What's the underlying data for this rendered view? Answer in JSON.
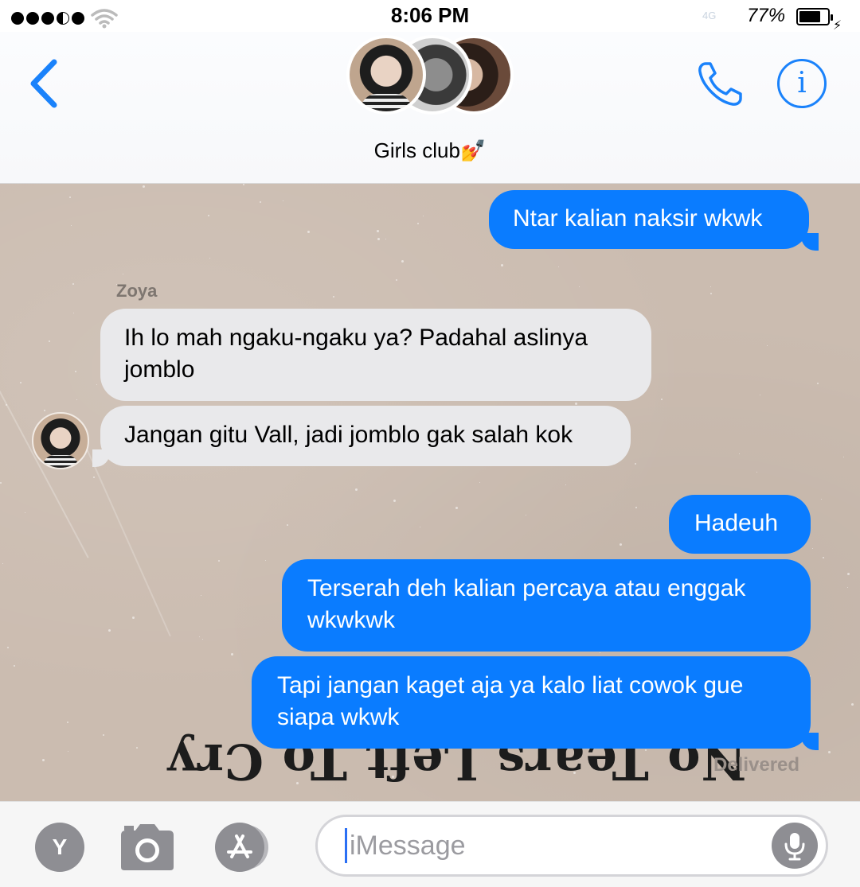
{
  "status_bar": {
    "time": "8:06 PM",
    "network": "4G",
    "battery": "77%",
    "battery_level": 0.77
  },
  "header": {
    "group_name": "Girls club",
    "group_emoji": "💅"
  },
  "messages": [
    {
      "direction": "outgoing",
      "text": "Ntar kalian naksir wkwk"
    },
    {
      "direction": "incoming",
      "sender": "Zoya",
      "text": "Ih lo mah ngaku-ngaku ya? Padahal aslinya jomblo"
    },
    {
      "direction": "incoming",
      "text": "Jangan gitu Vall, jadi jomblo gak salah kok"
    },
    {
      "direction": "outgoing",
      "text": "Hadeuh"
    },
    {
      "direction": "outgoing",
      "text": "Terserah deh kalian percaya atau enggak wkwkwk"
    },
    {
      "direction": "outgoing",
      "text": "Tapi jangan kaget aja ya kalo liat cowok gue siapa wkwk"
    }
  ],
  "wallpaper_text": "No Tears Left To Cry",
  "delivery_status": "Delivered",
  "input_bar": {
    "app_button_letter": "Y",
    "placeholder": "iMessage"
  },
  "colors": {
    "accent": "#0a7cff",
    "incoming_bubble": "#e9e9eb",
    "wallpaper": "#cbbcb0"
  }
}
